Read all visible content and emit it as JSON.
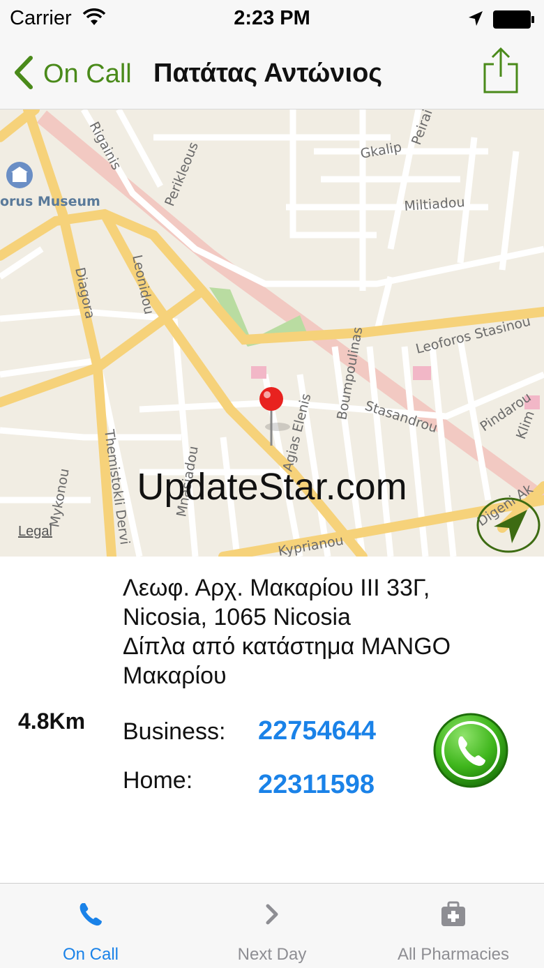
{
  "status_bar": {
    "carrier": "Carrier",
    "time": "2:23 PM"
  },
  "nav": {
    "back_label": "On Call",
    "title": "Πατάτας Αντώνιος",
    "accent_color": "#4a8a1a"
  },
  "map": {
    "street_labels": [
      "Rigainis",
      "Perikleous",
      "Gkalip",
      "Peirai",
      "Miltiadou",
      "orus Museum",
      "Diagora",
      "Leonidou",
      "Leoforos Stasinou",
      "Boumpoulinas",
      "Agias Elenis",
      "Stasandrou",
      "Pindarou",
      "Themistokli Dervi",
      "Mykonou",
      "Mnasiadou",
      "Kyprianou",
      "Digeni Ak",
      "Klim"
    ],
    "watermark": "UpdateStar.com",
    "legal_label": "Legal"
  },
  "details": {
    "address_lines": [
      "Λεωφ. Αρχ. Μακαρίου ΙΙΙ 33Γ,",
      "Nicosia, 1065 Nicosia",
      "Δίπλα από κατάστημα MANGO",
      "Μακαρίου"
    ],
    "distance": "4.8Km",
    "phones": [
      {
        "label": "Business:",
        "number": "22754644"
      },
      {
        "label": "Home:",
        "number": "22311598"
      }
    ],
    "link_color": "#1a82e8"
  },
  "tab_bar": {
    "tabs": [
      {
        "label": "On Call",
        "icon": "phone-icon",
        "active": true
      },
      {
        "label": "Next Day",
        "icon": "chevron-right-icon",
        "active": false
      },
      {
        "label": "All Pharmacies",
        "icon": "first-aid-kit-icon",
        "active": false
      }
    ],
    "active_color": "#1a82e8",
    "inactive_color": "#8e8e93"
  }
}
